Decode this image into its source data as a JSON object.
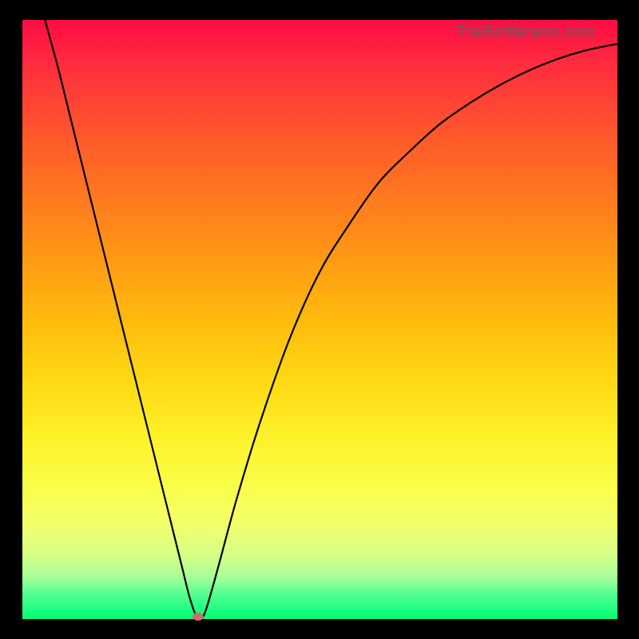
{
  "watermark": "TheBottleneck.com",
  "colors": {
    "frame": "#000000",
    "top": "#ff0b45",
    "bottom": "#00ff7a",
    "curve": "#000000",
    "marker": "#cf6d6d",
    "watermark": "#5f5f5f"
  },
  "chart_data": {
    "type": "line",
    "title": "",
    "xlabel": "",
    "ylabel": "",
    "xlim": [
      0,
      100
    ],
    "ylim": [
      0,
      100
    ],
    "series": [
      {
        "name": "bottleneck-curve",
        "x": [
          3.8,
          6,
          8,
          10,
          12,
          14,
          16,
          18,
          20,
          22,
          24,
          26,
          27,
          28,
          29,
          30,
          31,
          33,
          36,
          40,
          45,
          50,
          55,
          60,
          65,
          70,
          75,
          80,
          85,
          90,
          95,
          100
        ],
        "values": [
          100,
          92,
          84,
          76,
          68,
          60,
          52,
          44,
          36,
          28,
          20,
          12,
          8,
          4,
          1,
          0,
          2,
          9,
          20,
          33,
          47,
          58,
          66,
          73,
          78,
          82.5,
          86,
          89,
          91.5,
          93.5,
          95,
          96
        ]
      }
    ],
    "marker": {
      "x": 29.5,
      "y": 0
    },
    "notes": "x and y in percent of plot area; y=0 at bottom (green), y=100 at top (red)."
  }
}
